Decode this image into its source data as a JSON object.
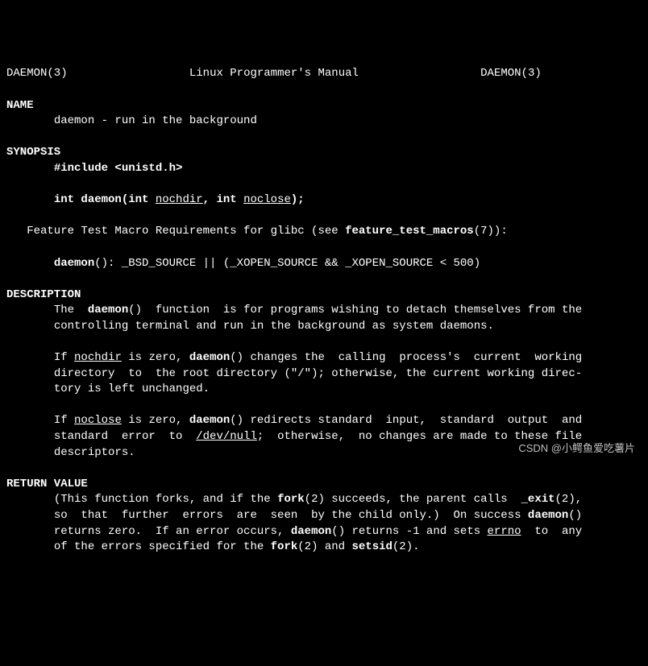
{
  "header": {
    "left": "DAEMON(3)",
    "center": "Linux Programmer's Manual",
    "right": "DAEMON(3)"
  },
  "sections": {
    "name": {
      "title": "NAME",
      "line": "daemon - run in the background"
    },
    "synopsis": {
      "title": "SYNOPSIS",
      "include_pre": "#include <",
      "include_hdr": "unistd.h",
      "include_post": ">",
      "sig1": "int daemon(int ",
      "arg1": "nochdir",
      "sig2": ", int ",
      "arg2": "noclose",
      "sig3": ");",
      "ftm_pre": "   Feature Test Macro Requirements for glibc (see ",
      "ftm_bold": "feature_test_macros",
      "ftm_post": "(7)):",
      "ftm2_pre": "       ",
      "ftm2_bold": "daemon",
      "ftm2_post": "(): _BSD_SOURCE || (_XOPEN_SOURCE && _XOPEN_SOURCE < 500)"
    },
    "description": {
      "title": "DESCRIPTION",
      "p1a": "The  ",
      "p1b": "daemon",
      "p1c": "()  function  is for programs wishing to detach themselves from the",
      "p1d": "controlling terminal and run in the background as system daemons.",
      "p2a": "If ",
      "p2b": "nochdir",
      "p2c": " is zero, ",
      "p2d": "daemon",
      "p2e": "() changes the  calling  process's  current  working",
      "p2f": "directory  to  the root directory (\"/\"); otherwise, the current working direc-",
      "p2g": "tory is left unchanged.",
      "p3a": "If ",
      "p3b": "noclose",
      "p3c": " is zero, ",
      "p3d": "daemon",
      "p3e": "() redirects standard  input,  standard  output  and",
      "p3f": "standard  error  to  ",
      "p3g": "/dev/null",
      "p3h": ";  otherwise,  no changes are made to these file",
      "p3i": "descriptors."
    },
    "return": {
      "title": "RETURN VALUE",
      "p1a": "(This function forks, and if the ",
      "p1b": "fork",
      "p1c": "(2) succeeds, the parent calls  ",
      "p1d": "_exit",
      "p1e": "(2),",
      "p2a": "so  that  further  errors  are  seen  by the child only.)  On success ",
      "p2b": "daemon",
      "p2c": "()",
      "p3a": "returns zero.  If an error occurs, ",
      "p3b": "daemon",
      "p3c": "() returns -1 and sets ",
      "p3d": "errno",
      "p3e": "  to  any",
      "p4a": "of the errors specified for the ",
      "p4b": "fork",
      "p4c": "(2) and ",
      "p4d": "setsid",
      "p4e": "(2)."
    }
  },
  "watermark": "CSDN @小鳄鱼爱吃薯片"
}
